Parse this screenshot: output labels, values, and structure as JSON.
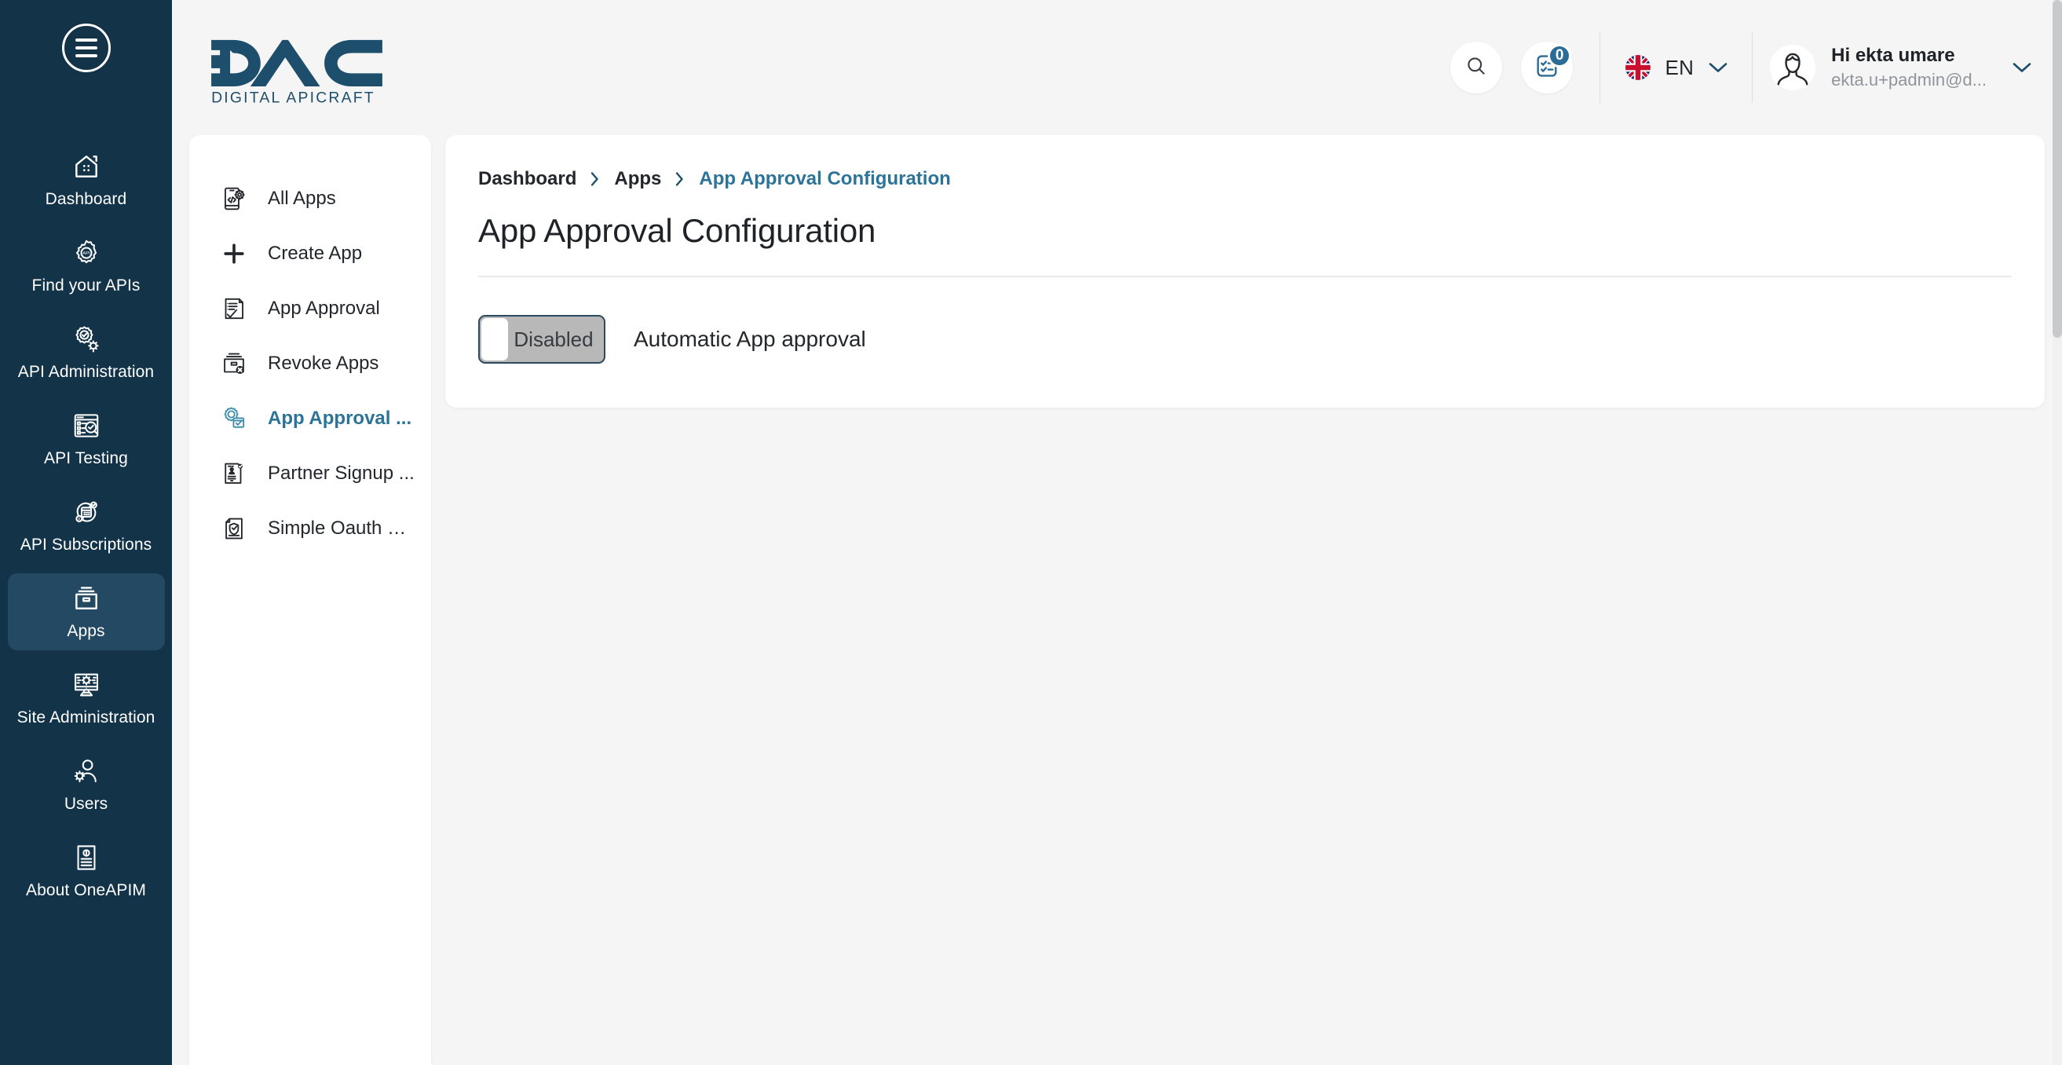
{
  "brand": {
    "logo_text": "DAC",
    "logo_subtext": "DIGITAL APICRAFT",
    "primary_color": "#1d4e6b",
    "sidebar_color": "#133349",
    "accent_color": "#2b7397"
  },
  "sidebar": {
    "menu_toggle_name": "hamburger-menu",
    "items": [
      {
        "label": "Dashboard",
        "icon": "dashboard-home-icon",
        "active": false
      },
      {
        "label": "Find your APIs",
        "icon": "api-gear-icon",
        "active": false
      },
      {
        "label": "API Administration",
        "icon": "api-admin-gear-icon",
        "active": false
      },
      {
        "label": "API Testing",
        "icon": "api-testing-icon",
        "active": false
      },
      {
        "label": "API Subscriptions",
        "icon": "api-subscriptions-icon",
        "active": false
      },
      {
        "label": "Apps",
        "icon": "apps-box-icon",
        "active": true
      },
      {
        "label": "Site Administration",
        "icon": "site-admin-monitor-icon",
        "active": false
      },
      {
        "label": "Users",
        "icon": "users-gear-icon",
        "active": false
      },
      {
        "label": "About OneAPIM",
        "icon": "about-document-icon",
        "active": false
      }
    ]
  },
  "header": {
    "search_icon": "search-icon",
    "tasks_icon": "tasks-checklist-icon",
    "tasks_badge": "0",
    "language": {
      "code": "EN",
      "flag": "uk-flag-icon",
      "chevron": "chevron-down-icon"
    },
    "profile": {
      "greeting": "Hi ekta umare",
      "email": "ekta.u+padmin@d...",
      "avatar_icon": "user-avatar-icon",
      "chevron": "chevron-down-icon"
    }
  },
  "subnav": {
    "items": [
      {
        "label": "All Apps",
        "icon": "all-apps-icon",
        "active": false
      },
      {
        "label": "Create App",
        "icon": "plus-icon",
        "active": false
      },
      {
        "label": "App Approval",
        "icon": "app-approval-doc-icon",
        "active": false
      },
      {
        "label": "Revoke Apps",
        "icon": "revoke-apps-icon",
        "active": false
      },
      {
        "label": "App Approval ...",
        "icon": "app-approval-config-icon",
        "active": true
      },
      {
        "label": "Partner Signup ...",
        "icon": "partner-signup-icon",
        "active": false
      },
      {
        "label": "Simple Oauth C...",
        "icon": "simple-oauth-shield-icon",
        "active": false
      }
    ]
  },
  "main": {
    "breadcrumb": [
      {
        "label": "Dashboard",
        "current": false
      },
      {
        "label": "Apps",
        "current": false
      },
      {
        "label": "App Approval Configuration",
        "current": true
      }
    ],
    "title": "App Approval Configuration",
    "settings": [
      {
        "toggle_state_label": "Disabled",
        "enabled": false,
        "label": "Automatic App approval"
      }
    ]
  }
}
